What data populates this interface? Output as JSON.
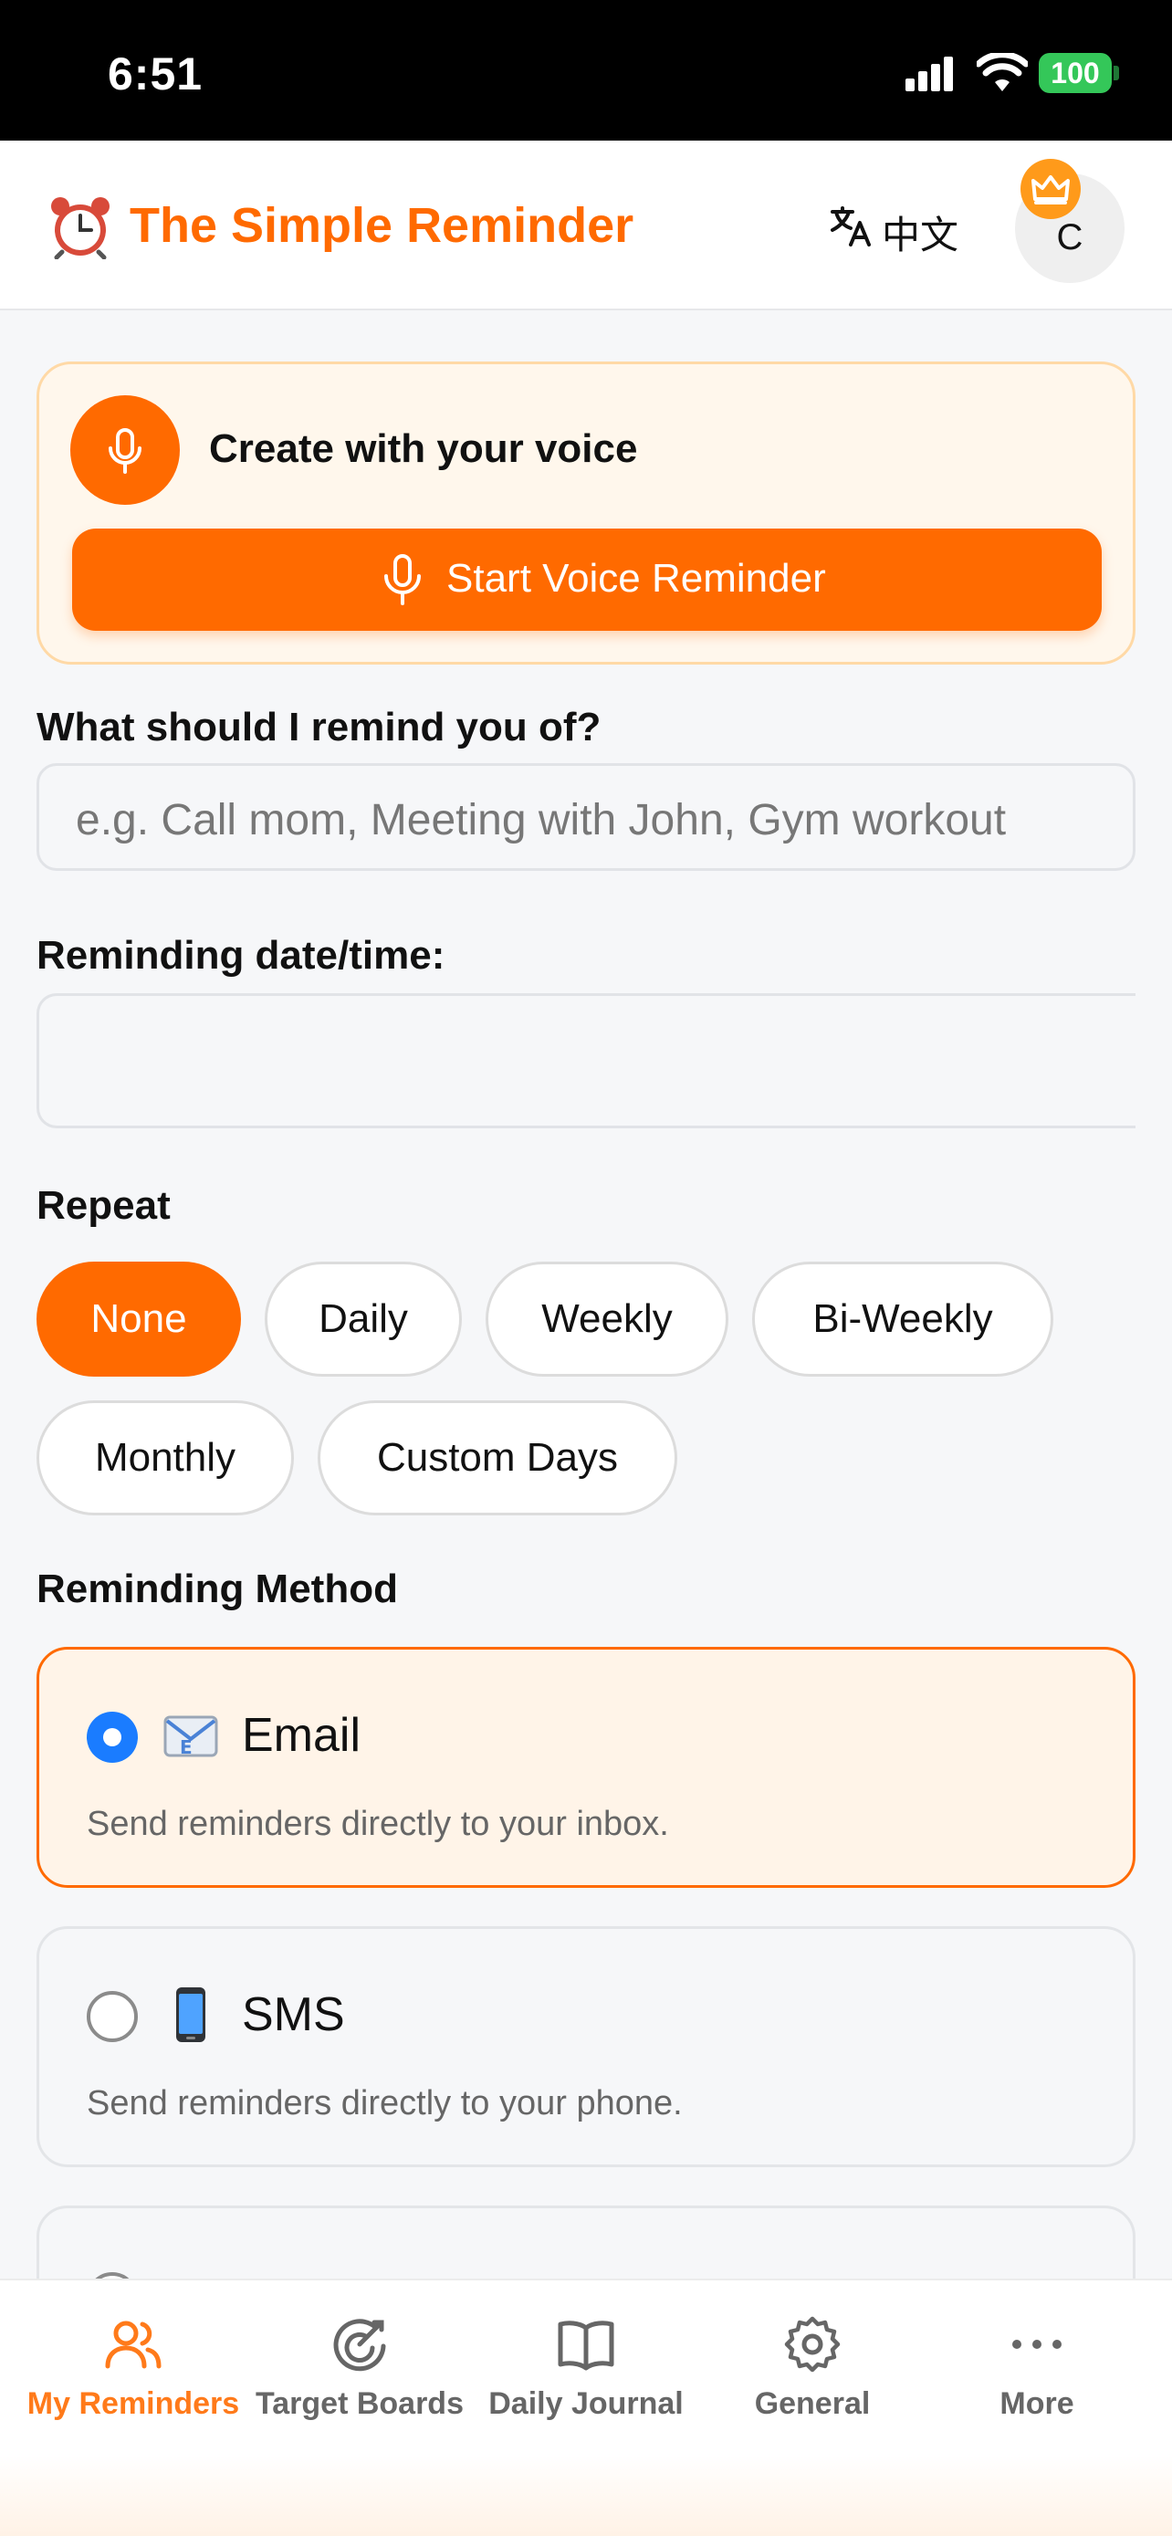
{
  "status_bar": {
    "time": "6:51",
    "battery": "100"
  },
  "header": {
    "title": "The Simple Reminder",
    "language_label": "中文",
    "avatar_initial": "C"
  },
  "voice": {
    "title": "Create with your voice",
    "button_label": "Start Voice Reminder"
  },
  "form": {
    "reminder_label": "What should I remind you of?",
    "reminder_placeholder": "e.g. Call mom, Meeting with John, Gym workout",
    "datetime_label": "Reminding date/time:",
    "datetime_value": "",
    "repeat_label": "Repeat",
    "repeat_options": [
      "None",
      "Daily",
      "Weekly",
      "Bi-Weekly",
      "Monthly",
      "Custom Days"
    ],
    "repeat_selected": "None",
    "method_label": "Reminding Method",
    "methods": [
      {
        "icon": "email-icon",
        "title": "Email",
        "description": "Send reminders directly to your inbox.",
        "selected": true
      },
      {
        "icon": "mobile-phone-icon",
        "title": "SMS",
        "description": "Send reminders directly to your phone.",
        "selected": false
      }
    ]
  },
  "nav": {
    "items": [
      {
        "label": "My Reminders",
        "icon": "users-icon",
        "active": true
      },
      {
        "label": "Target Boards",
        "icon": "target-icon",
        "active": false
      },
      {
        "label": "Daily Journal",
        "icon": "book-icon",
        "active": false
      },
      {
        "label": "General",
        "icon": "gear-icon",
        "active": false
      },
      {
        "label": "More",
        "icon": "more-icon",
        "active": false
      }
    ]
  },
  "colors": {
    "accent": "#ff6a00",
    "selected_radio": "#1a7cff"
  }
}
